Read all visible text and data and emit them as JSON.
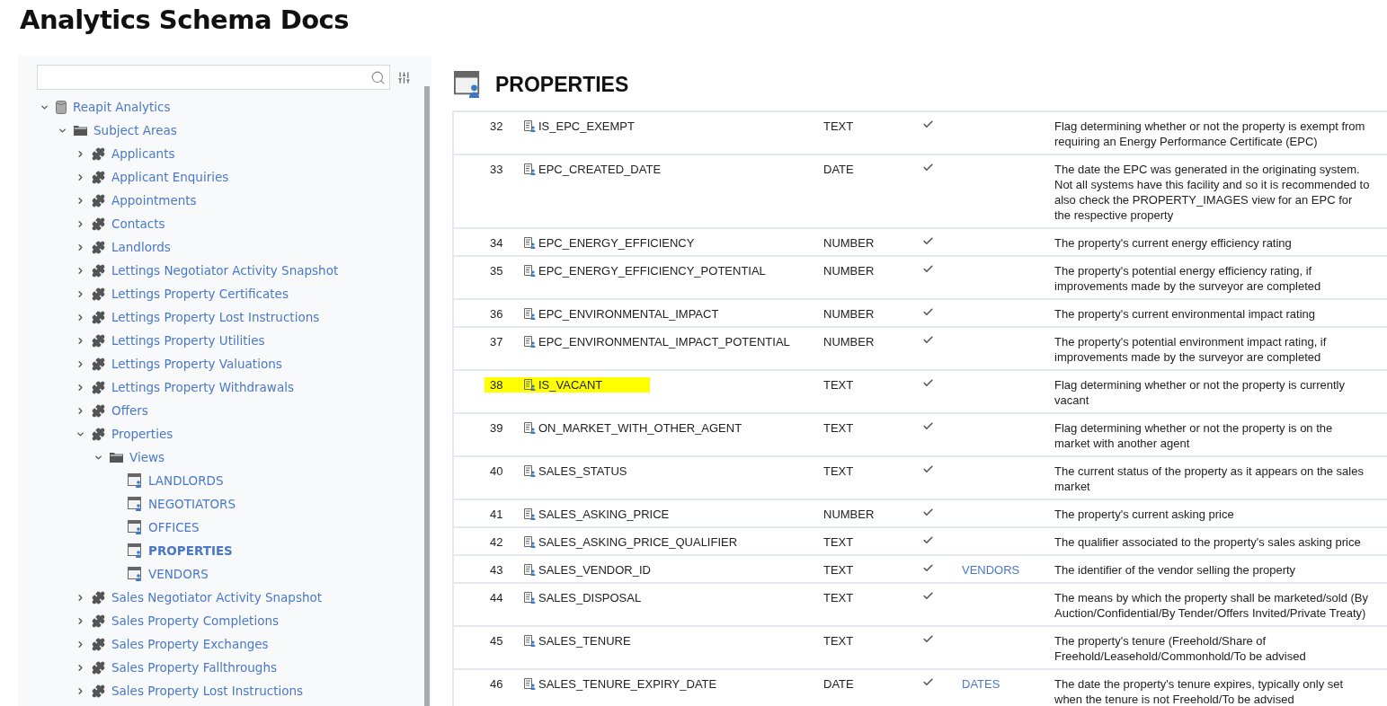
{
  "page_title": "Analytics Schema Docs",
  "tree": [
    {
      "label": "Reapit Analytics",
      "kind": "database",
      "expanded": true,
      "selected": false,
      "children": [
        {
          "label": "Subject Areas",
          "kind": "folder",
          "expanded": true,
          "selected": false,
          "children": [
            {
              "label": "Applicants",
              "kind": "module",
              "expanded": false,
              "selected": false
            },
            {
              "label": "Applicant Enquiries",
              "kind": "module",
              "expanded": false,
              "selected": false
            },
            {
              "label": "Appointments",
              "kind": "module",
              "expanded": false,
              "selected": false
            },
            {
              "label": "Contacts",
              "kind": "module",
              "expanded": false,
              "selected": false
            },
            {
              "label": "Landlords",
              "kind": "module",
              "expanded": false,
              "selected": false
            },
            {
              "label": "Lettings Negotiator Activity Snapshot",
              "kind": "module",
              "expanded": false,
              "selected": false
            },
            {
              "label": "Lettings Property Certificates",
              "kind": "module",
              "expanded": false,
              "selected": false
            },
            {
              "label": "Lettings Property Lost Instructions",
              "kind": "module",
              "expanded": false,
              "selected": false
            },
            {
              "label": "Lettings Property Utilities",
              "kind": "module",
              "expanded": false,
              "selected": false
            },
            {
              "label": "Lettings Property Valuations",
              "kind": "module",
              "expanded": false,
              "selected": false
            },
            {
              "label": "Lettings Property Withdrawals",
              "kind": "module",
              "expanded": false,
              "selected": false
            },
            {
              "label": "Offers",
              "kind": "module",
              "expanded": false,
              "selected": false
            },
            {
              "label": "Properties",
              "kind": "module",
              "expanded": true,
              "selected": false,
              "children": [
                {
                  "label": "Views",
                  "kind": "folder",
                  "expanded": true,
                  "selected": false,
                  "children": [
                    {
                      "label": "LANDLORDS",
                      "kind": "view",
                      "selected": false
                    },
                    {
                      "label": "NEGOTIATORS",
                      "kind": "view",
                      "selected": false
                    },
                    {
                      "label": "OFFICES",
                      "kind": "view",
                      "selected": false
                    },
                    {
                      "label": "PROPERTIES",
                      "kind": "view",
                      "selected": true
                    },
                    {
                      "label": "VENDORS",
                      "kind": "view",
                      "selected": false
                    }
                  ]
                }
              ]
            },
            {
              "label": "Sales Negotiator Activity Snapshot",
              "kind": "module",
              "expanded": false,
              "selected": false
            },
            {
              "label": "Sales Property Completions",
              "kind": "module",
              "expanded": false,
              "selected": false
            },
            {
              "label": "Sales Property Exchanges",
              "kind": "module",
              "expanded": false,
              "selected": false
            },
            {
              "label": "Sales Property Fallthroughs",
              "kind": "module",
              "expanded": false,
              "selected": false
            },
            {
              "label": "Sales Property Lost Instructions",
              "kind": "module",
              "expanded": false,
              "selected": false
            }
          ]
        }
      ]
    }
  ],
  "view": {
    "title": "PROPERTIES",
    "rows": [
      {
        "number": "32",
        "name": "IS_EPC_EXEMPT",
        "type": "TEXT",
        "nullable": true,
        "highlighted": false,
        "description": "Flag determining whether or not the property is exempt from requiring an Energy Performance Certificate (EPC)"
      },
      {
        "number": "33",
        "name": "EPC_CREATED_DATE",
        "type": "DATE",
        "nullable": true,
        "highlighted": false,
        "description": "The date the EPC was generated in the originating system. Not all systems have this facility and so it is recommended to also check the PROPERTY_IMAGES view for an EPC for the respective property"
      },
      {
        "number": "34",
        "name": "EPC_ENERGY_EFFICIENCY",
        "type": "NUMBER",
        "nullable": true,
        "highlighted": false,
        "description": "The property's current energy efficiency rating"
      },
      {
        "number": "35",
        "name": "EPC_ENERGY_EFFICIENCY_POTENTIAL",
        "type": "NUMBER",
        "nullable": true,
        "highlighted": false,
        "description": "The property's potential energy efficiency rating, if improvements made by the surveyor are completed"
      },
      {
        "number": "36",
        "name": "EPC_ENVIRONMENTAL_IMPACT",
        "type": "NUMBER",
        "nullable": true,
        "highlighted": false,
        "description": "The property's current environmental impact rating"
      },
      {
        "number": "37",
        "name": "EPC_ENVIRONMENTAL_IMPACT_POTENTIAL",
        "type": "NUMBER",
        "nullable": true,
        "highlighted": false,
        "description": "The property's potential environment impact rating, if improvements made by the surveyor are completed"
      },
      {
        "number": "38",
        "name": "IS_VACANT",
        "type": "TEXT",
        "nullable": true,
        "highlighted": true,
        "description": "Flag determining whether or not the property is currently vacant"
      },
      {
        "number": "39",
        "name": "ON_MARKET_WITH_OTHER_AGENT",
        "type": "TEXT",
        "nullable": true,
        "highlighted": false,
        "description": "Flag determining whether or not the property is on the market with another agent"
      },
      {
        "number": "40",
        "name": "SALES_STATUS",
        "type": "TEXT",
        "nullable": true,
        "highlighted": false,
        "description": "The current status of the property as it appears on the sales market"
      },
      {
        "number": "41",
        "name": "SALES_ASKING_PRICE",
        "type": "NUMBER",
        "nullable": true,
        "highlighted": false,
        "description": "The property's current asking price"
      },
      {
        "number": "42",
        "name": "SALES_ASKING_PRICE_QUALIFIER",
        "type": "TEXT",
        "nullable": true,
        "highlighted": false,
        "description": "The qualifier associated to the property's sales asking price"
      },
      {
        "number": "43",
        "name": "SALES_VENDOR_ID",
        "type": "TEXT",
        "nullable": true,
        "highlighted": false,
        "link": "VENDORS",
        "description": "The identifier of the vendor selling the property"
      },
      {
        "number": "44",
        "name": "SALES_DISPOSAL",
        "type": "TEXT",
        "nullable": true,
        "highlighted": false,
        "description": "The means by which the property shall be marketed/sold (By Auction/Confidential/By Tender/Offers Invited/Private Treaty)"
      },
      {
        "number": "45",
        "name": "SALES_TENURE",
        "type": "TEXT",
        "nullable": true,
        "highlighted": false,
        "description": "The property's tenure (Freehold/Share of Freehold/Leasehold/Commonhold/To be advised"
      },
      {
        "number": "46",
        "name": "SALES_TENURE_EXPIRY_DATE",
        "type": "DATE",
        "nullable": true,
        "highlighted": false,
        "link": "DATES",
        "description": "The date the property's tenure expires, typically only set when the tenure is not Freehold/To be advised"
      }
    ]
  }
}
